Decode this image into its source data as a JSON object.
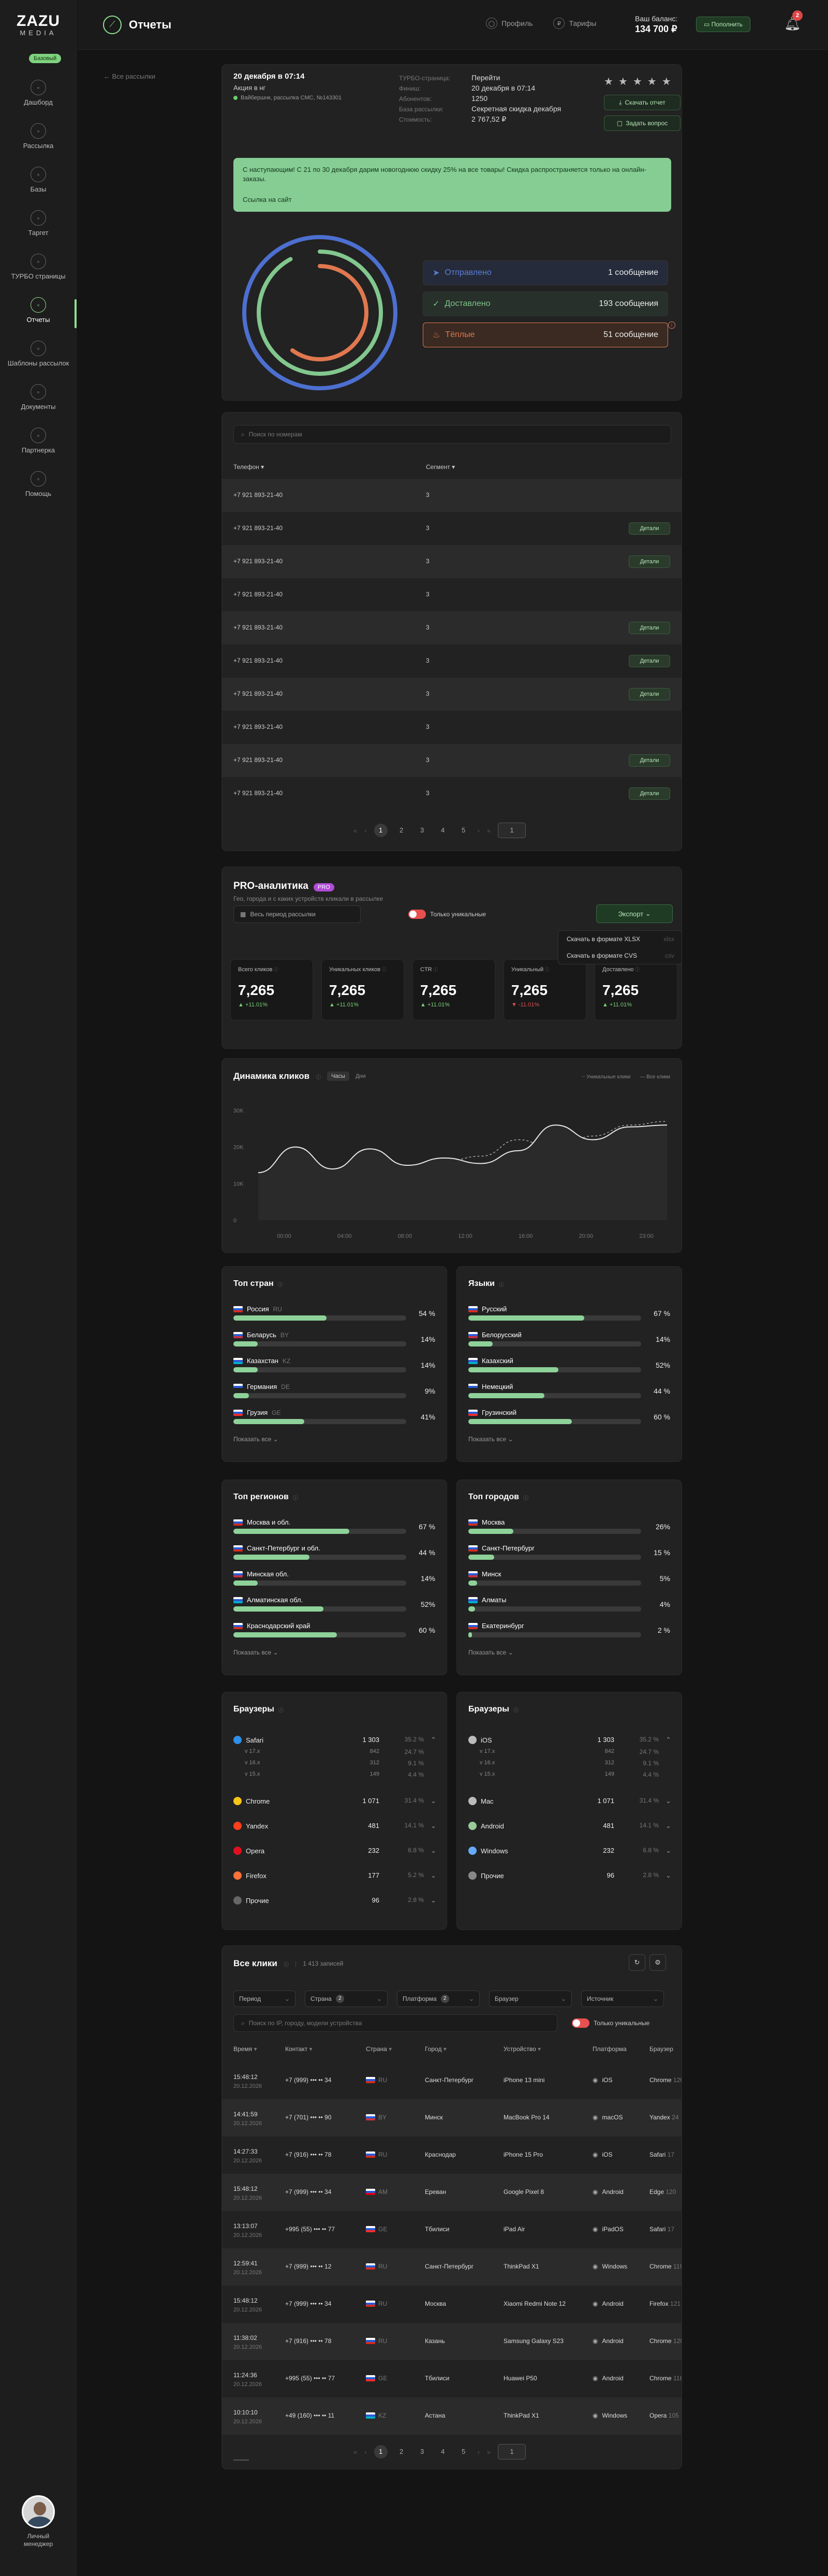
{
  "sidebar": {
    "logo_top": "ZAZU",
    "logo_bottom": "MEDIA",
    "plan_badge": "Базовый",
    "items": [
      {
        "label": "Дашборд",
        "icon": "dashboard-icon"
      },
      {
        "label": "Рассылка",
        "icon": "mailing-icon"
      },
      {
        "label": "Базы",
        "icon": "database-icon"
      },
      {
        "label": "Таргет",
        "icon": "target-icon"
      },
      {
        "label": "ТУРБО страницы",
        "icon": "turbo-icon"
      },
      {
        "label": "Отчеты",
        "icon": "reports-icon"
      },
      {
        "label": "Шаблоны рассылок",
        "icon": "templates-icon"
      },
      {
        "label": "Документы",
        "icon": "documents-icon"
      },
      {
        "label": "Партнерка",
        "icon": "partner-icon"
      },
      {
        "label": "Помощь",
        "icon": "help-icon"
      }
    ],
    "manager_label_1": "Личный",
    "manager_label_2": "менеджер"
  },
  "header": {
    "title": "Отчеты",
    "profile": "Профиль",
    "tariffs": "Тарифы",
    "balance_label": "Ваш баланс:",
    "balance_value": "134 700 ₽",
    "topup": "Пополнить",
    "notifications": "2"
  },
  "back_link": "← Все рассылки",
  "campaign": {
    "date": "20 декабря в 07:14",
    "name": "Акция в нг",
    "source": "Вайбершнк, рассылка СМС, №143301",
    "meta": [
      {
        "k": "ТУРБО-страница:",
        "v": "Перейти"
      },
      {
        "k": "Финиш:",
        "v": "20 декабря в 07:14"
      },
      {
        "k": "Абонентов:",
        "v": "1250"
      },
      {
        "k": "База рассылки:",
        "v": "Секретная скидка декабря"
      },
      {
        "k": "Стоимость:",
        "v": "2 767,52 ₽"
      }
    ],
    "stars": "★★★★★",
    "download": "Скачать отчет",
    "ask": "Задать вопрос",
    "notice_text": "С наступающим! С 21 по 30 декабря дарим новогоднюю скидку 25% на все товары! Скидка распространяется только на онлайн-заказы.",
    "notice_link": "Ссылка на сайт",
    "stats": [
      {
        "label": "Отправлено",
        "value": "1 сообщение",
        "color": "#5b7fd6"
      },
      {
        "label": "Доставлено",
        "value": "193 сообщения",
        "color": "#7fc48a"
      },
      {
        "label": "Тёплые",
        "value": "51 сообщение",
        "color": "#e0784f"
      }
    ],
    "rings": [
      {
        "name": "sent",
        "value": 1.0,
        "color": "#4d6fd0"
      },
      {
        "name": "delivered",
        "value": 0.92,
        "color": "#82c78e"
      },
      {
        "name": "warm",
        "value": 0.6,
        "color": "#e0784f"
      }
    ]
  },
  "phones": {
    "search_placeholder": "Поиск по номерам",
    "col_phone": "Телефон",
    "col_segment": "Сегмент",
    "details": "Детали",
    "rows": [
      {
        "phone": "+7 921 893-21-40",
        "segment": "3",
        "details": false
      },
      {
        "phone": "+7 921 893-21-40",
        "segment": "3",
        "details": true
      },
      {
        "phone": "+7 921 893-21-40",
        "segment": "3",
        "details": true
      },
      {
        "phone": "+7 921 893-21-40",
        "segment": "3",
        "details": false
      },
      {
        "phone": "+7 921 893-21-40",
        "segment": "3",
        "details": true
      },
      {
        "phone": "+7 921 893-21-40",
        "segment": "3",
        "details": true
      },
      {
        "phone": "+7 921 893-21-40",
        "segment": "3",
        "details": true
      },
      {
        "phone": "+7 921 893-21-40",
        "segment": "3",
        "details": false
      },
      {
        "phone": "+7 921 893-21-40",
        "segment": "3",
        "details": true
      },
      {
        "phone": "+7 921 893-21-40",
        "segment": "3",
        "details": true
      }
    ],
    "pages": [
      "1",
      "2",
      "3",
      "4",
      "5"
    ],
    "page_input": "1"
  },
  "pro": {
    "title": "PRO-аналитика",
    "badge": "PRO",
    "subtitle": "Гео, города и с каких устройств кликали в рассылке",
    "period": "Весь период рассылки",
    "unique_only": "Только уникальные",
    "export": "Экспорт",
    "export_xlsx": "Скачать в формате XLSX",
    "export_csv": "Скачать в формате CVS",
    "export_xlsx_ext": "xlsx",
    "export_csv_ext": "csv",
    "kpis": [
      {
        "label": "Всего кликов",
        "value": "7,265",
        "delta": "+11.01%",
        "dir": "up"
      },
      {
        "label": "Уникальных кликов",
        "value": "7,265",
        "delta": "+11.01%",
        "dir": "up"
      },
      {
        "label": "CTR",
        "value": "7,265",
        "delta": "+11.01%",
        "dir": "up"
      },
      {
        "label": "Уникальный",
        "value": "7,265",
        "delta": "-11.01%",
        "dir": "down"
      },
      {
        "label": "Доставлено",
        "value": "7,265",
        "delta": "+11.01%",
        "dir": "up"
      }
    ]
  },
  "chart_data": {
    "type": "line",
    "title": "Динамика кликов",
    "toggle_hours": "Часы",
    "toggle_days": "Дни",
    "x": [
      "00:00",
      "04:00",
      "08:00",
      "12:00",
      "16:00",
      "20:00",
      "23:00"
    ],
    "ylim": [
      0,
      30000
    ],
    "yticks": [
      "0",
      "10K",
      "20K",
      "30K"
    ],
    "series": [
      {
        "name": "Уникальные клики",
        "values": [
          11000,
          9000,
          13000,
          12000,
          10500,
          16000,
          17500,
          22000,
          19000,
          23000,
          26000,
          27000
        ],
        "style": "dashed"
      },
      {
        "name": "Все клики",
        "values": [
          13000,
          20000,
          14000,
          19500,
          15000,
          17000,
          15500,
          19000,
          26000,
          22000,
          25500,
          26000
        ],
        "style": "solid"
      }
    ]
  },
  "countries": {
    "title": "Топ стран",
    "show_all": "Показать все",
    "rows": [
      {
        "name": "Россия",
        "code": "RU",
        "pct": "54 %",
        "value": 0.54,
        "flag": "#d52b1e"
      },
      {
        "name": "Беларусь",
        "code": "BY",
        "pct": "14%",
        "value": 0.14,
        "flag": "#c8313e"
      },
      {
        "name": "Казахстан",
        "code": "KZ",
        "pct": "14%",
        "value": 0.14,
        "flag": "#00afca"
      },
      {
        "name": "Германия",
        "code": "DE",
        "pct": "9%",
        "value": 0.09,
        "flag": "#222"
      },
      {
        "name": "Грузия",
        "code": "GE",
        "pct": "41%",
        "value": 0.41,
        "flag": "#ff2b2b"
      }
    ]
  },
  "languages": {
    "title": "Языки",
    "show_all": "Показать все",
    "rows": [
      {
        "name": "Русский",
        "pct": "67 %",
        "value": 0.67,
        "flag": "#d52b1e"
      },
      {
        "name": "Белорусский",
        "pct": "14%",
        "value": 0.14,
        "flag": "#c8313e"
      },
      {
        "name": "Казахский",
        "pct": "52%",
        "value": 0.52,
        "flag": "#00afca"
      },
      {
        "name": "Немецкий",
        "pct": "44 %",
        "value": 0.44,
        "flag": "#222"
      },
      {
        "name": "Грузинский",
        "pct": "60 %",
        "value": 0.6,
        "flag": "#ff2b2b"
      }
    ]
  },
  "regions": {
    "title": "Топ регионов",
    "show_all": "Показать все",
    "rows": [
      {
        "name": "Москва и обл.",
        "pct": "67 %",
        "value": 0.67,
        "flag": "#d52b1e"
      },
      {
        "name": "Санкт-Петербург и обл.",
        "pct": "44 %",
        "value": 0.44,
        "flag": "#d52b1e"
      },
      {
        "name": "Минская обл.",
        "pct": "14%",
        "value": 0.14,
        "flag": "#c8313e"
      },
      {
        "name": "Алматинская обл.",
        "pct": "52%",
        "value": 0.52,
        "flag": "#00afca"
      },
      {
        "name": "Краснодарский край",
        "pct": "60 %",
        "value": 0.6,
        "flag": "#d52b1e"
      }
    ]
  },
  "cities": {
    "title": "Топ городов",
    "show_all": "Показать все",
    "rows": [
      {
        "name": "Москва",
        "pct": "26%",
        "value": 0.26,
        "flag": "#d52b1e"
      },
      {
        "name": "Санкт-Петербург",
        "pct": "15 %",
        "value": 0.15,
        "flag": "#d52b1e"
      },
      {
        "name": "Минск",
        "pct": "5%",
        "value": 0.05,
        "flag": "#c8313e"
      },
      {
        "name": "Алматы",
        "pct": "4%",
        "value": 0.04,
        "flag": "#00afca"
      },
      {
        "name": "Екатеринбург",
        "pct": "2 %",
        "value": 0.02,
        "flag": "#d52b1e"
      }
    ]
  },
  "browsers": {
    "title": "Браузеры",
    "rows": [
      {
        "name": "Safari",
        "v": "1 303",
        "p": "35.2 %",
        "c": "⌃",
        "color": "#2f8ee8",
        "subs": [
          [
            "v 17.x",
            "842",
            "24.7 %"
          ],
          [
            "v 16.x",
            "312",
            "9.1 %"
          ],
          [
            "v 15.x",
            "149",
            "4.4 %"
          ]
        ]
      },
      {
        "name": "Chrome",
        "v": "1 071",
        "p": "31.4 %",
        "c": "⌄",
        "color": "#f5c518"
      },
      {
        "name": "Yandex",
        "v": "481",
        "p": "14.1 %",
        "c": "⌄",
        "color": "#fc3f1d"
      },
      {
        "name": "Opera",
        "v": "232",
        "p": "6.8 %",
        "c": "⌄",
        "color": "#e01020"
      },
      {
        "name": "Firefox",
        "v": "177",
        "p": "5.2 %",
        "c": "⌄",
        "color": "#ff7139"
      },
      {
        "name": "Прочие",
        "v": "96",
        "p": "2.8 %",
        "c": "⌄",
        "color": "#666"
      }
    ]
  },
  "systems": {
    "title": "Браузеры",
    "rows": [
      {
        "name": "iOS",
        "v": "1 303",
        "p": "35.2 %",
        "c": "⌃",
        "color": "#bbb",
        "subs": [
          [
            "v 17.x",
            "842",
            "24.7 %"
          ],
          [
            "v 16.x",
            "312",
            "9.1 %"
          ],
          [
            "v 15.x",
            "149",
            "4.4 %"
          ]
        ]
      },
      {
        "name": "Mac",
        "v": "1 071",
        "p": "31.4 %",
        "c": "⌄",
        "color": "#bbb"
      },
      {
        "name": "Android",
        "v": "481",
        "p": "14.1 %",
        "c": "⌄",
        "color": "#9c9"
      },
      {
        "name": "Windows",
        "v": "232",
        "p": "6.8 %",
        "c": "⌄",
        "color": "#6af"
      },
      {
        "name": "Прочие",
        "v": "96",
        "p": "2.8 %",
        "c": "⌄",
        "color": "#888"
      }
    ]
  },
  "clicks": {
    "title": "Все клики",
    "count": "1 413 записей",
    "filters": [
      "Период",
      "Страна",
      "Платформа",
      "Браузер",
      "Источник"
    ],
    "filter_counts": [
      "",
      "2",
      "2",
      "",
      ""
    ],
    "search_placeholder": "Поиск по IP, городу, модели устройства",
    "unique_only": "Только уникальные",
    "columns": [
      "Время",
      "Контакт",
      "Страна",
      "Город",
      "Устройство",
      "Платформа",
      "Браузер"
    ],
    "rows": [
      {
        "t": "15:48:12",
        "d": "20.12.2026",
        "ph": "+7 (999) ••• •• 34",
        "cc": "RU",
        "f": "#d52b1e",
        "city": "Санкт-Петербург",
        "dev": "iPhone 13 mini",
        "pl": "iOS",
        "br": "Chrome",
        "bv": "120"
      },
      {
        "t": "14:41:59",
        "d": "20.12.2026",
        "ph": "+7 (701) ••• •• 90",
        "cc": "BY",
        "f": "#c8313e",
        "city": "Минск",
        "dev": "MacBook Pro 14",
        "pl": "macOS",
        "br": "Yandex",
        "bv": "24"
      },
      {
        "t": "14:27:33",
        "d": "20.12.2026",
        "ph": "+7 (916) ••• •• 78",
        "cc": "RU",
        "f": "#d52b1e",
        "city": "Краснодар",
        "dev": "iPhone 15 Pro",
        "pl": "iOS",
        "br": "Safari",
        "bv": "17"
      },
      {
        "t": "15:48:12",
        "d": "20.12.2026",
        "ph": "+7 (999) ••• •• 34",
        "cc": "AM",
        "f": "#d90012",
        "city": "Ереван",
        "dev": "Google Pixel 8",
        "pl": "Android",
        "br": "Edge",
        "bv": "120"
      },
      {
        "t": "13:13:07",
        "d": "20.12.2026",
        "ph": "+995 (55) ••• •• 77",
        "cc": "GE",
        "f": "#ff2b2b",
        "city": "Тбилиси",
        "dev": "iPad Air",
        "pl": "iPadOS",
        "br": "Safari",
        "bv": "17"
      },
      {
        "t": "12:59:41",
        "d": "20.12.2026",
        "ph": "+7 (999) ••• •• 12",
        "cc": "RU",
        "f": "#d52b1e",
        "city": "Санкт-Петербург",
        "dev": "ThinkPad X1",
        "pl": "Windows",
        "br": "Chrome",
        "bv": "119"
      },
      {
        "t": "15:48:12",
        "d": "20.12.2026",
        "ph": "+7 (999) ••• •• 34",
        "cc": "RU",
        "f": "#d52b1e",
        "city": "Москва",
        "dev": "Xiaomi Redmi Note 12",
        "pl": "Android",
        "br": "Firefox",
        "bv": "121"
      },
      {
        "t": "11:38:02",
        "d": "20.12.2026",
        "ph": "+7 (916) ••• •• 78",
        "cc": "RU",
        "f": "#d52b1e",
        "city": "Казань",
        "dev": "Samsung Galaxy S23",
        "pl": "Android",
        "br": "Chrome",
        "bv": "120"
      },
      {
        "t": "11:24:36",
        "d": "20.12.2026",
        "ph": "+995 (55) ••• •• 77",
        "cc": "GE",
        "f": "#ff2b2b",
        "city": "Тбилиси",
        "dev": "Huawei P50",
        "pl": "Android",
        "br": "Chrome",
        "bv": "118"
      },
      {
        "t": "10:10:10",
        "d": "20.12.2026",
        "ph": "+49 (160) ••• •• 11",
        "cc": "KZ",
        "f": "#00afca",
        "city": "Астана",
        "dev": "ThinkPad X1",
        "pl": "Windows",
        "br": "Opera",
        "bv": "105"
      }
    ],
    "pages": [
      "1",
      "2",
      "3",
      "4",
      "5"
    ],
    "page_input": "1"
  }
}
